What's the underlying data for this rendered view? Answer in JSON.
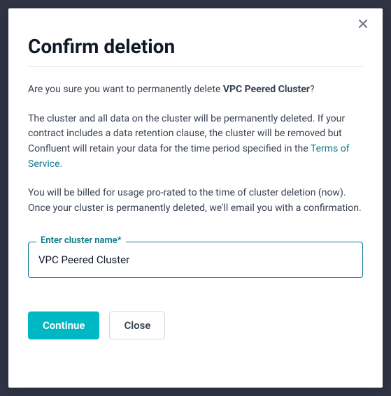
{
  "modal": {
    "title": "Confirm deletion",
    "confirm_prefix": "Are you sure you want to permanently delete ",
    "cluster_name_bold": "VPC Peered Cluster",
    "confirm_suffix": "?",
    "warning_prefix": "The cluster and all data on the cluster will be permanently deleted. If your contract includes a data retention clause, the cluster will be removed but Confluent will retain your data for the time period specified in the ",
    "tos_link": "Terms of Service",
    "warning_suffix": ".",
    "billing_text": "You will be billed for usage pro-rated to the time of cluster deletion (now). Once your cluster is permanently deleted, we'll email you with a confirmation.",
    "field_label": "Enter cluster name*",
    "field_value": "VPC Peered Cluster",
    "continue_label": "Continue",
    "close_label": "Close"
  }
}
